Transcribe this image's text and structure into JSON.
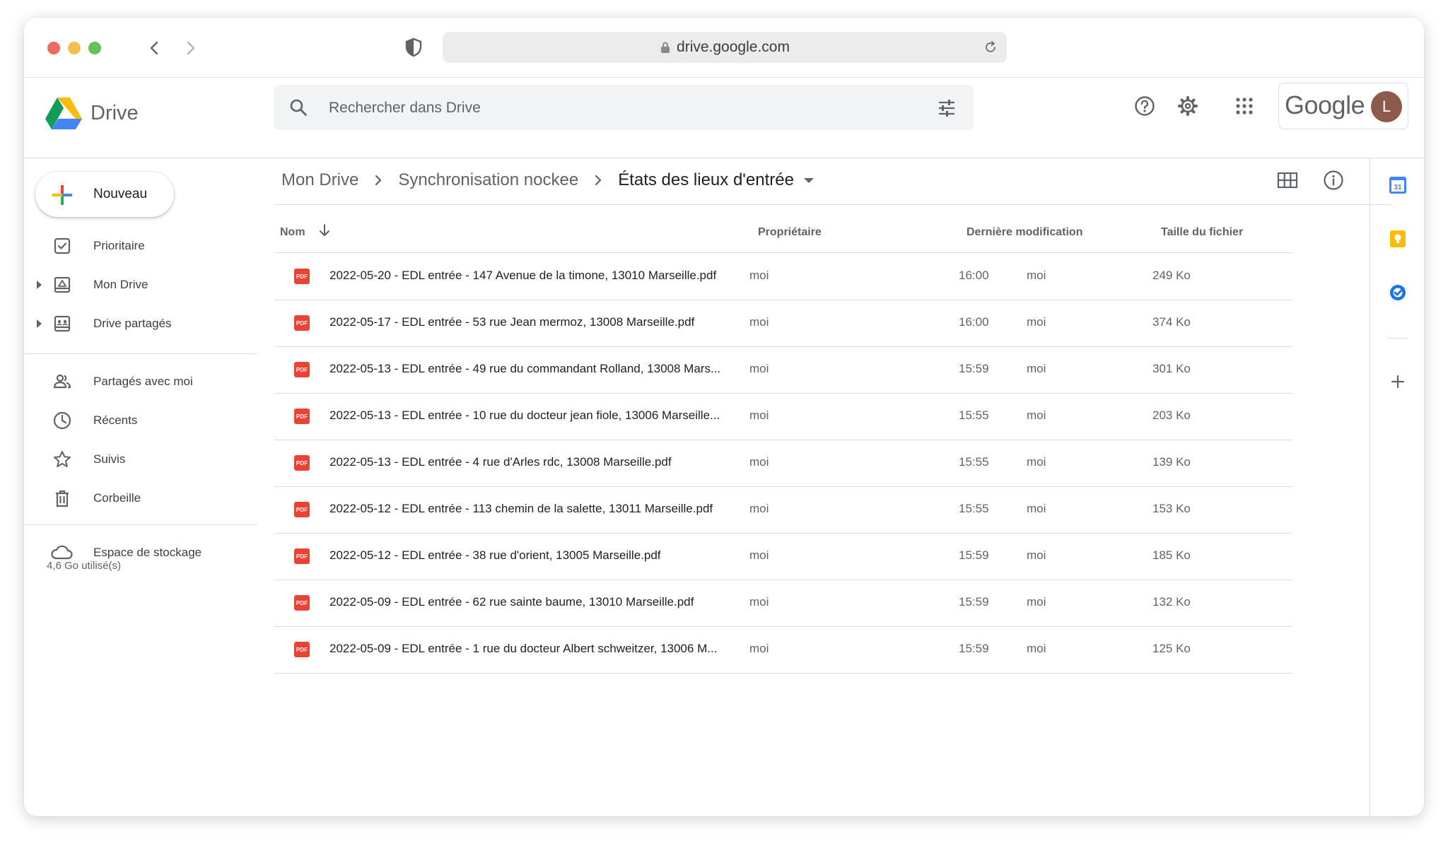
{
  "browser": {
    "url": "drive.google.com"
  },
  "app": {
    "brand": "Drive",
    "search_placeholder": "Rechercher dans Drive",
    "account_word": "Google",
    "avatar_initial": "L"
  },
  "sidebar": {
    "new_label": "Nouveau",
    "items": [
      {
        "label": "Prioritaire",
        "icon": "check-box-icon"
      },
      {
        "label": "Mon Drive",
        "icon": "my-drive-icon"
      },
      {
        "label": "Drive partagés",
        "icon": "shared-drives-icon"
      },
      {
        "label": "Partagés avec moi",
        "icon": "people-icon"
      },
      {
        "label": "Récents",
        "icon": "clock-icon"
      },
      {
        "label": "Suivis",
        "icon": "star-icon"
      },
      {
        "label": "Corbeille",
        "icon": "trash-icon"
      },
      {
        "label": "Espace de stockage",
        "icon": "cloud-icon"
      }
    ],
    "storage_used": "4,6 Go utilisé(s)"
  },
  "breadcrumb": {
    "items": [
      "Mon Drive",
      "Synchronisation nockee",
      "États des lieux d'entrée"
    ]
  },
  "table": {
    "headers": {
      "name": "Nom",
      "owner": "Propriétaire",
      "modified": "Dernière modification",
      "size": "Taille du fichier"
    },
    "rows": [
      {
        "name": "2022-05-20 - EDL entrée - 147 Avenue de la timone, 13010 Marseille.pdf",
        "owner": "moi",
        "time": "16:00",
        "by": "moi",
        "size": "249 Ko"
      },
      {
        "name": "2022-05-17 - EDL entrée - 53 rue Jean mermoz, 13008 Marseille.pdf",
        "owner": "moi",
        "time": "16:00",
        "by": "moi",
        "size": "374 Ko"
      },
      {
        "name": "2022-05-13 - EDL entrée - 49 rue du commandant Rolland, 13008 Mars...",
        "owner": "moi",
        "time": "15:59",
        "by": "moi",
        "size": "301 Ko"
      },
      {
        "name": "2022-05-13 - EDL entrée - 10 rue du docteur jean fiole, 13006 Marseille...",
        "owner": "moi",
        "time": "15:55",
        "by": "moi",
        "size": "203 Ko"
      },
      {
        "name": "2022-05-13 - EDL entrée - 4 rue d'Arles rdc, 13008 Marseille.pdf",
        "owner": "moi",
        "time": "15:55",
        "by": "moi",
        "size": "139 Ko"
      },
      {
        "name": "2022-05-12 - EDL entrée - 113 chemin de la salette, 13011 Marseille.pdf",
        "owner": "moi",
        "time": "15:55",
        "by": "moi",
        "size": "153 Ko"
      },
      {
        "name": "2022-05-12 - EDL entrée - 38 rue d'orient, 13005 Marseille.pdf",
        "owner": "moi",
        "time": "15:59",
        "by": "moi",
        "size": "185 Ko"
      },
      {
        "name": "2022-05-09 - EDL entrée - 62 rue sainte baume, 13010 Marseille.pdf",
        "owner": "moi",
        "time": "15:59",
        "by": "moi",
        "size": "132 Ko"
      },
      {
        "name": "2022-05-09 - EDL entrée - 1 rue du docteur Albert schweitzer, 13006 M...",
        "owner": "moi",
        "time": "15:59",
        "by": "moi",
        "size": "125 Ko"
      }
    ],
    "file_badge": "PDF"
  },
  "rail": {
    "calendar_day": "31"
  },
  "colors": {
    "pdf_red": "#ea4335",
    "google_blue": "#4285f4",
    "google_yellow": "#fbbc04",
    "google_green": "#34a853",
    "avatar_brown": "#8d5b4c"
  }
}
